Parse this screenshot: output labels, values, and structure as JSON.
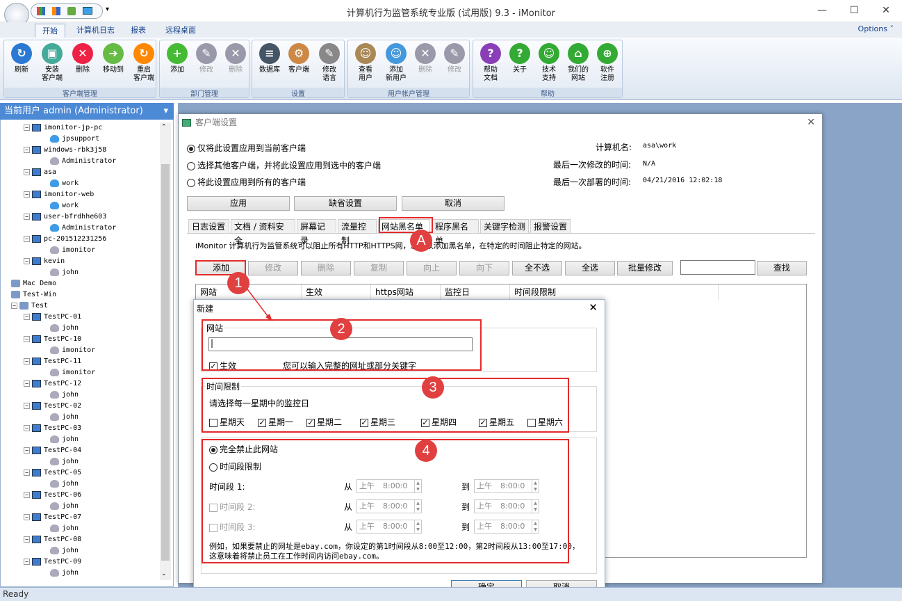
{
  "window": {
    "title": "计算机行为监管系统专业版 (试用版) 9.3 - iMonitor",
    "min": "—",
    "max": "☐",
    "close": "✕"
  },
  "tabs": [
    "开始",
    "计算机日志",
    "报表",
    "远程桌面"
  ],
  "options": "Options ˅",
  "ribbon": {
    "groups": [
      {
        "label": "客户端管理",
        "buttons": [
          "刷新",
          "安装\n客户端",
          "删除",
          "移动到",
          "重启\n客户端"
        ]
      },
      {
        "label": "部门管理",
        "buttons": [
          "添加",
          "修改",
          "删除"
        ]
      },
      {
        "label": "设置",
        "buttons": [
          "数据库",
          "客户端",
          "修改\n语言"
        ]
      },
      {
        "label": "用户帐户管理",
        "buttons": [
          "查看\n用户",
          "添加\n新用户",
          "删除",
          "修改"
        ]
      },
      {
        "label": "帮助",
        "buttons": [
          "帮助\n文档",
          "关于",
          "技术\n支持",
          "我们的\n网站",
          "软件\n注册"
        ]
      }
    ]
  },
  "sidebar": {
    "header": "当前用户 admin (Administrator)",
    "tree": [
      {
        "t": "imonitor-jp-pc",
        "lvl": 1,
        "k": "pc"
      },
      {
        "t": "jpsupport",
        "lvl": 2,
        "k": "user"
      },
      {
        "t": "windows-rbk3j58",
        "lvl": 1,
        "k": "pc"
      },
      {
        "t": "Administrator",
        "lvl": 2,
        "k": "gray"
      },
      {
        "t": "asa",
        "lvl": 1,
        "k": "pc"
      },
      {
        "t": "work",
        "lvl": 2,
        "k": "user"
      },
      {
        "t": "imonitor-web",
        "lvl": 1,
        "k": "pc"
      },
      {
        "t": "work",
        "lvl": 2,
        "k": "user"
      },
      {
        "t": "user-bfrdhhe603",
        "lvl": 1,
        "k": "pc"
      },
      {
        "t": "Administrator",
        "lvl": 2,
        "k": "user"
      },
      {
        "t": "pc-201512231256",
        "lvl": 1,
        "k": "pc"
      },
      {
        "t": "imonitor",
        "lvl": 2,
        "k": "gray"
      },
      {
        "t": "kevin",
        "lvl": 1,
        "k": "pc"
      },
      {
        "t": "john",
        "lvl": 2,
        "k": "gray"
      },
      {
        "t": "Mac Demo",
        "lvl": 0,
        "k": "grp"
      },
      {
        "t": "Test-Win",
        "lvl": 0,
        "k": "grp"
      },
      {
        "t": "Test",
        "lvl": 0,
        "k": "grp"
      },
      {
        "t": "TestPC-01",
        "lvl": 1,
        "k": "pc"
      },
      {
        "t": "john",
        "lvl": 2,
        "k": "gray"
      },
      {
        "t": "TestPC-10",
        "lvl": 1,
        "k": "pc"
      },
      {
        "t": "imonitor",
        "lvl": 2,
        "k": "gray"
      },
      {
        "t": "TestPC-11",
        "lvl": 1,
        "k": "pc"
      },
      {
        "t": "imonitor",
        "lvl": 2,
        "k": "gray"
      },
      {
        "t": "TestPC-12",
        "lvl": 1,
        "k": "pc"
      },
      {
        "t": "john",
        "lvl": 2,
        "k": "gray"
      },
      {
        "t": "TestPC-02",
        "lvl": 1,
        "k": "pc"
      },
      {
        "t": "john",
        "lvl": 2,
        "k": "gray"
      },
      {
        "t": "TestPC-03",
        "lvl": 1,
        "k": "pc"
      },
      {
        "t": "john",
        "lvl": 2,
        "k": "gray"
      },
      {
        "t": "TestPC-04",
        "lvl": 1,
        "k": "pc"
      },
      {
        "t": "john",
        "lvl": 2,
        "k": "gray"
      },
      {
        "t": "TestPC-05",
        "lvl": 1,
        "k": "pc"
      },
      {
        "t": "john",
        "lvl": 2,
        "k": "gray"
      },
      {
        "t": "TestPC-06",
        "lvl": 1,
        "k": "pc"
      },
      {
        "t": "john",
        "lvl": 2,
        "k": "gray"
      },
      {
        "t": "TestPC-07",
        "lvl": 1,
        "k": "pc"
      },
      {
        "t": "john",
        "lvl": 2,
        "k": "gray"
      },
      {
        "t": "TestPC-08",
        "lvl": 1,
        "k": "pc"
      },
      {
        "t": "john",
        "lvl": 2,
        "k": "gray"
      },
      {
        "t": "TestPC-09",
        "lvl": 1,
        "k": "pc"
      },
      {
        "t": "john",
        "lvl": 2,
        "k": "gray"
      }
    ]
  },
  "status": "Ready",
  "client_dialog": {
    "title": "客户端设置",
    "radio1": "仅将此设置应用到当前客户端",
    "radio2": "选择其他客户端，并将此设置应用到选中的客户端",
    "radio3": "将此设置应用到所有的客户端",
    "computer_label": "计算机名:",
    "computer_value": "asa\\work",
    "lastmod_label": "最后一次修改的时间:",
    "lastmod_value": "N/A",
    "lastdeploy_label": "最后一次部署的时间:",
    "lastdeploy_value": "04/21/2016 12:02:18",
    "apply": "应用",
    "default": "缺省设置",
    "cancel": "取消",
    "tabs": [
      "日志设置",
      "文档 / 资料安全",
      "屏幕记录",
      "流量控制",
      "网站黑名单",
      "程序黑名单",
      "关键字检测",
      "报警设置"
    ],
    "description": "iMonitor 计算机行为监管系统可以阻止所有HTTP和HTTPS网，您可以添加黑名单，在特定的时间阻止特定的网站。",
    "toolbar": [
      "添加",
      "修改",
      "删除",
      "复制",
      "向上",
      "向下",
      "全不选",
      "全选",
      "批量修改"
    ],
    "search": "查找",
    "columns": [
      "网站",
      "生效",
      "https网站",
      "监控日",
      "时间段限制"
    ]
  },
  "new_dialog": {
    "title": "新建",
    "site_group": "网站",
    "site_value": "",
    "enabled": "生效",
    "hint": "您可以输入完整的网址或部分关键字",
    "time_group": "时间限制",
    "choose_days": "请选择每一星期中的监控日",
    "days": [
      {
        "l": "星期天",
        "c": false
      },
      {
        "l": "星期一",
        "c": true
      },
      {
        "l": "星期二",
        "c": true
      },
      {
        "l": "星期三",
        "c": true
      },
      {
        "l": "星期四",
        "c": true
      },
      {
        "l": "星期五",
        "c": true
      },
      {
        "l": "星期六",
        "c": false
      }
    ],
    "block_all": "完全禁止此网站",
    "time_limit": "时间段限制",
    "periods": [
      {
        "l": "时间段 1:"
      },
      {
        "l": "时间段 2:"
      },
      {
        "l": "时间段 3:"
      }
    ],
    "from": "从",
    "to": "到",
    "time_am": "上午",
    "time_val": "8:00:0",
    "example": "例如，如果要禁止的网址是ebay.com，你设定的第1时间段从8:00至12:00，第2时间段从13:00至17:00，这意味着将禁止员工在工作时间内访问ebay.com。",
    "ok": "确定",
    "cancel": "取消"
  },
  "annotations": [
    "A",
    "1",
    "2",
    "3",
    "4"
  ]
}
